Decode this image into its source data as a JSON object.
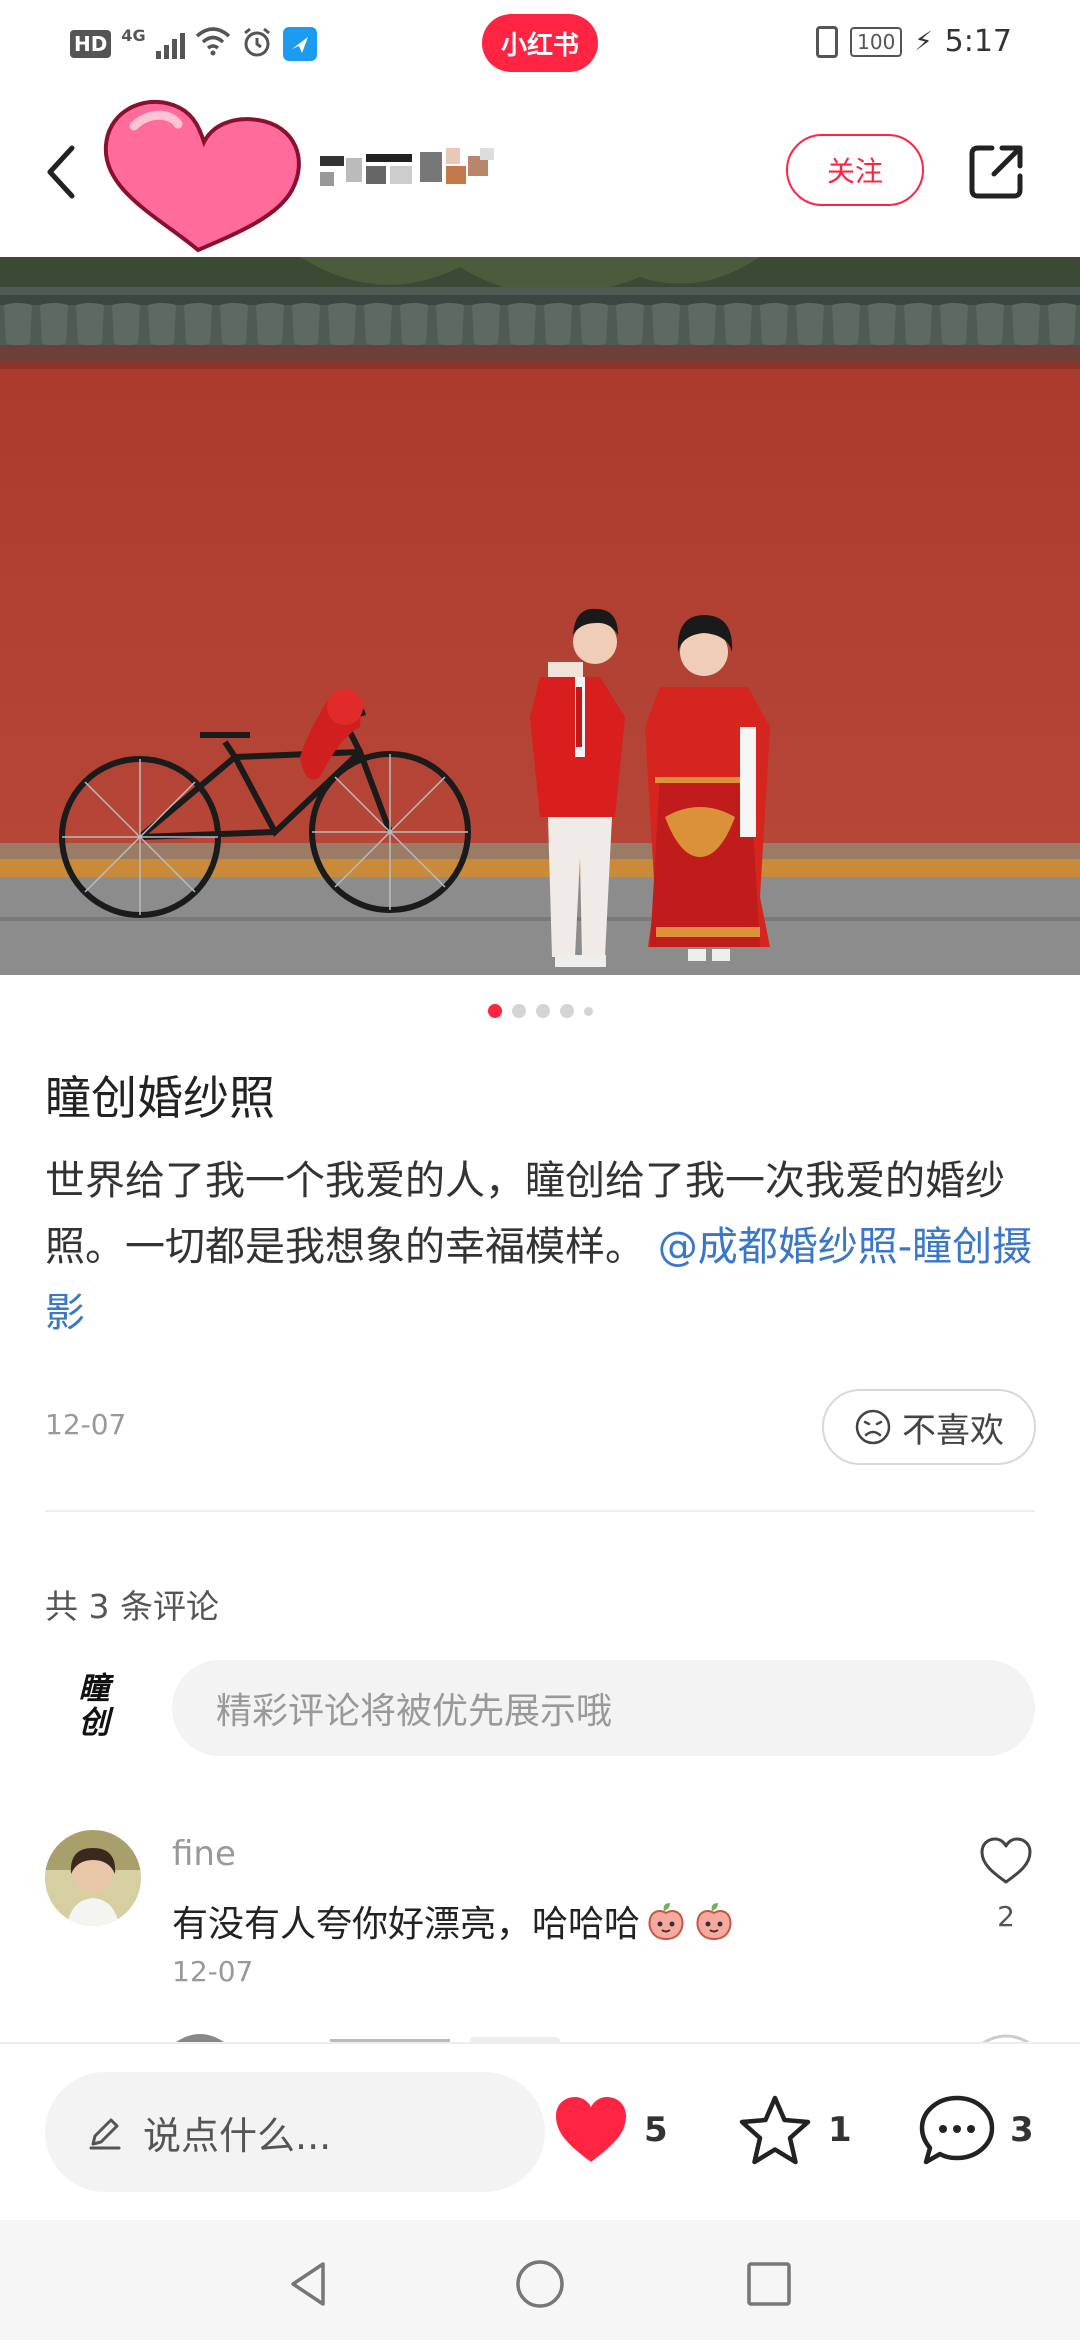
{
  "status_bar": {
    "hd": "HD",
    "network": "4G",
    "brand": "小红书",
    "battery": "100",
    "time": "5:17"
  },
  "header": {
    "follow_label": "关注",
    "icons": [
      "back-arrow-icon",
      "heart-sticker-icon",
      "share-icon"
    ]
  },
  "gallery": {
    "total_images": 5,
    "current_index": 1
  },
  "post": {
    "title": "瞳创婚纱照",
    "body": "世界给了我一个我爱的人，瞳创给了我一次我爱的婚纱照。一切都是我想象的幸福模样。",
    "mention": "@成都婚纱照-瞳创摄影",
    "date": "12-07",
    "dislike_label": "不喜欢"
  },
  "comments_section": {
    "count_label": "共 3 条评论",
    "my_avatar_text": "瞳\n创",
    "input_placeholder": "精彩评论将被优先展示哦",
    "items": [
      {
        "name": "fine",
        "text": "有没有人夸你好漂亮，哈哈哈",
        "date": "12-07",
        "likes": "2"
      }
    ]
  },
  "action_bar": {
    "say_placeholder": "说点什么...",
    "likes": "5",
    "favorites": "1",
    "comments": "3"
  },
  "colors": {
    "brand_red": "#ff2442",
    "link_blue": "#3a76c9",
    "wall_red": "#b3402f"
  }
}
